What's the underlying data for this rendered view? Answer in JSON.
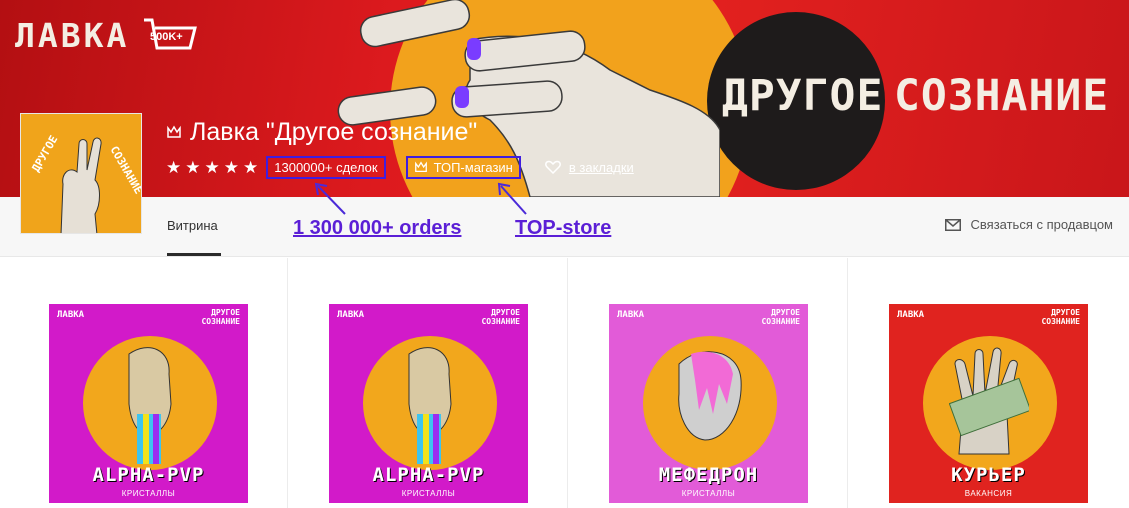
{
  "banner": {
    "logo_text": "ЛАВКА",
    "basket_badge": "500K+",
    "art_word_1": "ДРУГОЕ",
    "art_word_2": "СОЗНАНИЕ"
  },
  "shop": {
    "title": "Лавка \"Другое сознание\"",
    "rating_stars": 5,
    "deals": "1300000+ сделок",
    "top_badge": "ТОП-магазин",
    "bookmarks": "в закладки"
  },
  "nav": {
    "tab_label": "Витрина",
    "contact_label": "Связаться с продавцом"
  },
  "annotations": {
    "orders": "1 300 000+  orders",
    "top": "TOP-store"
  },
  "products": [
    {
      "name": "ALPHA-PVP",
      "category": "КРИСТАЛЛЫ",
      "brand_left": "ЛАВКА",
      "brand_right": "ДРУГОЕ\nСОЗНАНИЕ",
      "bg": "#d21ac9"
    },
    {
      "name": "ALPHA-PVP",
      "category": "КРИСТАЛЛЫ",
      "brand_left": "ЛАВКА",
      "brand_right": "ДРУГОЕ\nСОЗНАНИЕ",
      "bg": "#d21ac9"
    },
    {
      "name": "МЕФЕДРОН",
      "category": "КРИСТАЛЛЫ",
      "brand_left": "ЛАВКА",
      "brand_right": "ДРУГОЕ\nСОЗНАНИЕ",
      "bg": "#e25bd8"
    },
    {
      "name": "КУРЬЕР",
      "category": "ВАКАНСИЯ",
      "brand_left": "ЛАВКА",
      "brand_right": "ДРУГОЕ\nСОЗНАНИЕ",
      "bg": "#e0231f"
    }
  ],
  "colors": {
    "banner_red": "#dd1a1e",
    "accent_orange": "#f2a21c",
    "annotation_purple": "#5b1fd6",
    "highlight_border": "#3f1ee0"
  }
}
